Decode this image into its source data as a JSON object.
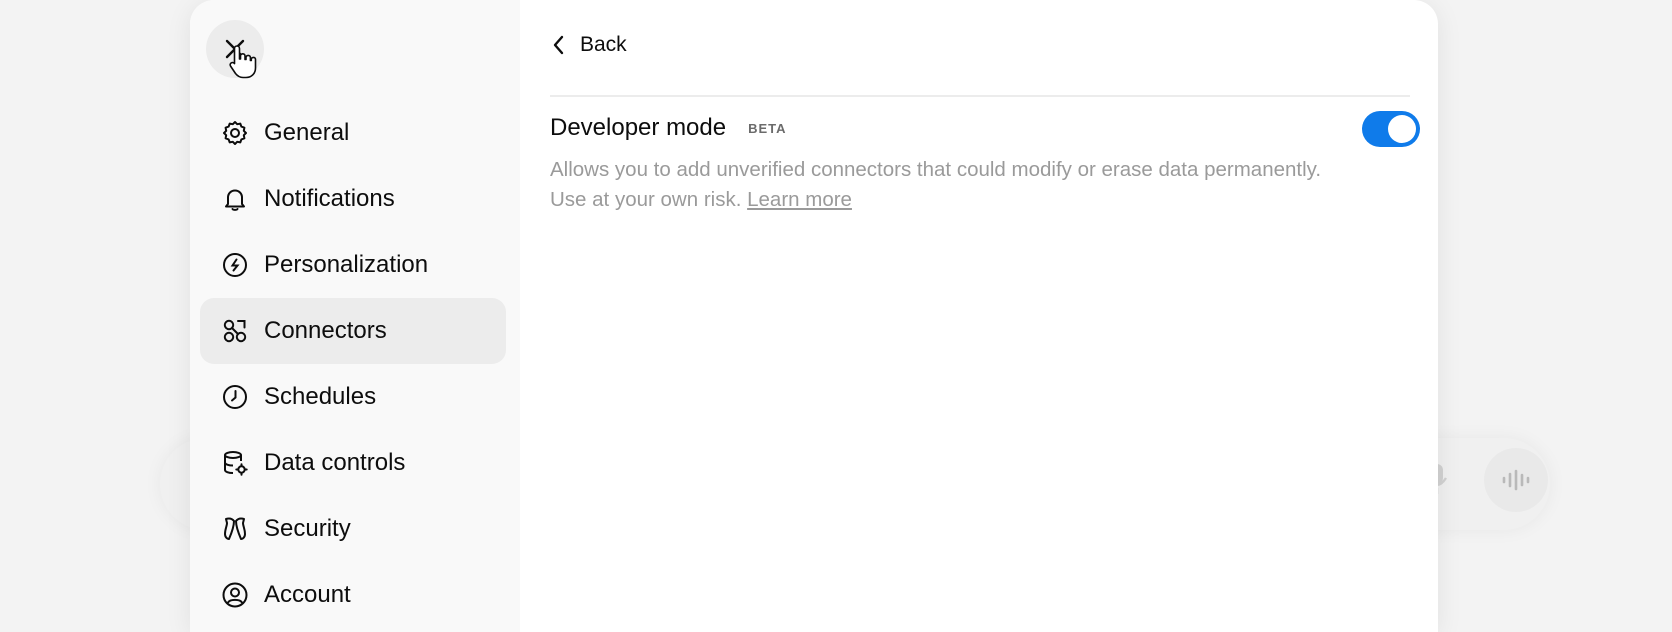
{
  "colors": {
    "accent": "#0f7bea",
    "sidebar_bg": "#f9f9f9",
    "active_item_bg": "#ececec",
    "muted_text": "#9a9a9a"
  },
  "sidebar": {
    "close_icon": "close-icon",
    "items": [
      {
        "label": "General",
        "icon": "gear-icon",
        "active": false
      },
      {
        "label": "Notifications",
        "icon": "bell-icon",
        "active": false
      },
      {
        "label": "Personalization",
        "icon": "personalization-icon",
        "active": false
      },
      {
        "label": "Connectors",
        "icon": "connectors-icon",
        "active": true
      },
      {
        "label": "Schedules",
        "icon": "clock-icon",
        "active": false
      },
      {
        "label": "Data controls",
        "icon": "database-gear-icon",
        "active": false
      },
      {
        "label": "Security",
        "icon": "security-icon",
        "active": false
      },
      {
        "label": "Account",
        "icon": "user-circle-icon",
        "active": false
      }
    ]
  },
  "content": {
    "back_label": "Back",
    "developer_mode": {
      "title": "Developer mode",
      "badge": "BETA",
      "enabled": true,
      "description": "Allows you to add unverified connectors that could modify or erase data permanently. Use at your own risk.",
      "link_label": "Learn more"
    }
  }
}
